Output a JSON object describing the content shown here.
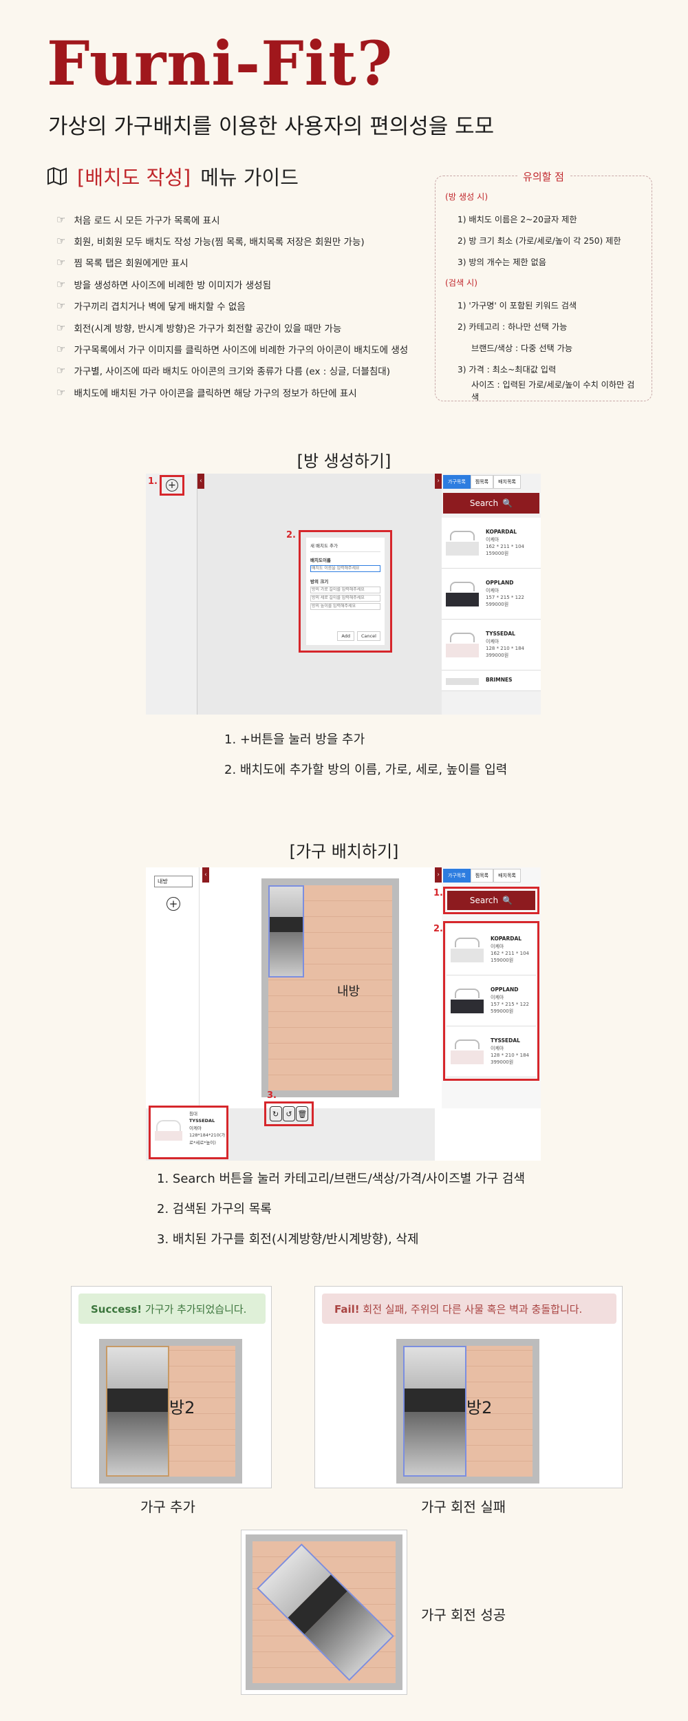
{
  "brand": "Furni-Fit?",
  "subtitle": "가상의 가구배치를 이용한 사용자의 편의성을 도모",
  "guide": {
    "icon": "map-icon",
    "title_accent": "[배치도 작성]",
    "title_rest": "메뉴 가이드",
    "items": [
      "처음 로드 시 모든 가구가 목록에 표시",
      "회원, 비회원 모두 배치도 작성 가능(찜 목록, 배치목록 저장은 회원만 가능)",
      "찜 목록 탭은 회원에게만 표시",
      "방을 생성하면 사이즈에 비례한 방 이미지가 생성됨",
      "가구끼리 겹치거나 벽에 닿게 배치할 수 없음",
      "회전(시계 방향, 반시계 방향)은 가구가 회전할 공간이 있을 때만 가능",
      "가구목록에서 가구 이미지를 클릭하면 사이즈에 비례한 가구의 아이콘이 배치도에 생성",
      "가구별, 사이즈에 따라 배치도 아이콘의 크기와 종류가 다름 (ex : 싱글, 더블침대)",
      "배치도에 배치된 가구 아이콘을 클릭하면 해당 가구의 정보가 하단에 표시"
    ]
  },
  "caution": {
    "title": "유의할 점",
    "room_header": "(방 생성 시)",
    "room_rows": [
      "1)  배치도 이름은 2~20글자 제한",
      "2)  방 크기 최소 (가로/세로/높이 각 250) 제한",
      "3)  방의 개수는 제한 없음"
    ],
    "search_header": "(검색 시)",
    "search_rows": [
      "1)  '가구명' 이 포함된 키워드 검색",
      "2)  카테고리 : 하나만 선택 가능",
      "브랜드/색상 : 다중 선택 가능",
      "3)  가격 : 최소~최대값 입력",
      "사이즈 : 입력된 가로/세로/높이 수치 이하만 검색"
    ]
  },
  "section1": {
    "title": "[방 생성하기]",
    "markers": [
      "1.",
      "2."
    ],
    "tabs": [
      "가구목록",
      "찜목록",
      "배치목록"
    ],
    "search_label": "Search",
    "modal": {
      "title": "새 배치도 추가",
      "name_label": "배치도이름",
      "name_placeholder": "배치도 이름을 입력해주세요",
      "size_label": "방의 크기",
      "size_placeholders": [
        "방의 가로 길이를 입력해주세요",
        "방의 세로 길이를 입력해주세요",
        "방의 높이를 입력해주세요"
      ],
      "add": "Add",
      "cancel": "Cancel"
    },
    "items": [
      {
        "name": "KOPARDAL",
        "brand": "이케아",
        "size": "162 * 211 * 104",
        "price": "159000원",
        "color": "#e4e4e4"
      },
      {
        "name": "OPPLAND",
        "brand": "이케아",
        "size": "157 * 215 * 122",
        "price": "599000원",
        "color": "#2d2d33"
      },
      {
        "name": "TYSSEDAL",
        "brand": "이케아",
        "size": "128 * 210 * 184",
        "price": "399000원",
        "color": "#f2e4e4"
      },
      {
        "name": "BRIMNES",
        "brand": "",
        "size": "",
        "price": "",
        "color": "#e0e0e0"
      }
    ],
    "captions": [
      "1. +버튼을 눌러 방을 추가",
      "2. 배치도에 추가할 방의 이름, 가로, 세로, 높이를 입력"
    ]
  },
  "section2": {
    "title": "[가구 배치하기]",
    "markers": [
      "1.",
      "2.",
      "3."
    ],
    "room_item": "내방",
    "room_name": "내방",
    "tabs": [
      "가구목록",
      "찜목록",
      "배치목록"
    ],
    "search_label": "Search",
    "items": [
      {
        "name": "KOPARDAL",
        "brand": "이케아",
        "size": "162 * 211 * 104",
        "price": "159000원",
        "color": "#e4e4e4"
      },
      {
        "name": "OPPLAND",
        "brand": "이케아",
        "size": "157 * 215 * 122",
        "price": "599000원",
        "color": "#2d2d33"
      },
      {
        "name": "TYSSEDAL",
        "brand": "이케아",
        "size": "128 * 210 * 184",
        "price": "399000원",
        "color": "#f2e4e4"
      }
    ],
    "info": {
      "category": "침대",
      "name": "TYSSEDAL",
      "brand": "이케아",
      "size": "128*184*210(가로*세로*높이)"
    },
    "action_icons": [
      "rotate-clockwise-icon",
      "rotate-counterclockwise-icon",
      "trash-icon"
    ],
    "captions": [
      "1. Search 버튼을 눌러 카테고리/브랜드/색상/가격/사이즈별 가구 검색",
      "2. 검색된 가구의 목록",
      "3. 배치된 가구를 회전(시계방향/반시계방향), 삭제"
    ]
  },
  "section3": {
    "success_strong": "Success!",
    "success_text": " 가구가 추가되었습니다.",
    "fail_strong": "Fail!",
    "fail_text": " 회전 실패, 주위의 다른 사물 혹은 벽과 충돌합니다.",
    "room_label": "방2",
    "caption_add": "가구 추가",
    "caption_fail": "가구 회전 실패",
    "caption_success": "가구 회전 성공"
  },
  "colors": {
    "brand_red": "#a0171c",
    "accent_red": "#c0262b",
    "marker_red": "#d6262b",
    "tab_blue": "#2d7de0",
    "success_bg": "#dff0d8",
    "success_fg": "#3c763d",
    "fail_bg": "#f2dede",
    "fail_fg": "#a94442"
  }
}
